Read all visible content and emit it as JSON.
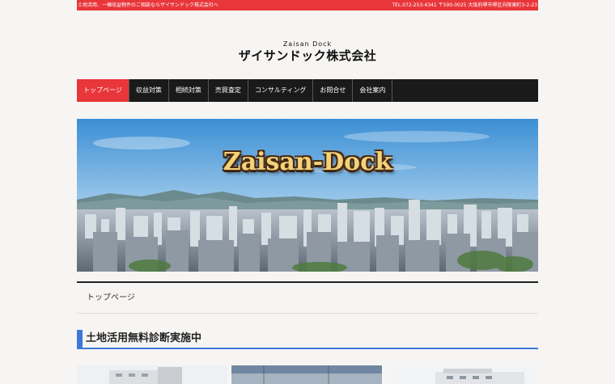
{
  "topbar": {
    "tagline": "土地活用、一棟収益物件のご相談ならザイサンドック株式会社へ",
    "contact": "TEL.072-253-4341 〒590-0025 大阪府堺市堺区向陵東町3-2-23"
  },
  "logo": {
    "en": "Zaisan Dock",
    "jp": "ザイサンドック株式会社"
  },
  "nav": {
    "items": [
      {
        "label": "トップページ"
      },
      {
        "label": "収益対策"
      },
      {
        "label": "相続対策"
      },
      {
        "label": "売買査定"
      },
      {
        "label": "コンサルティング"
      },
      {
        "label": "お問合せ"
      },
      {
        "label": "会社案内"
      }
    ]
  },
  "hero": {
    "title": "Zaisan-Dock"
  },
  "breadcrumb": {
    "current": "トップページ"
  },
  "section": {
    "heading": "土地活用無料診断実施中"
  },
  "colors": {
    "accent_red": "#e8363b",
    "nav_bg": "#1a1a1a",
    "heading_blue": "#3b78d8"
  }
}
